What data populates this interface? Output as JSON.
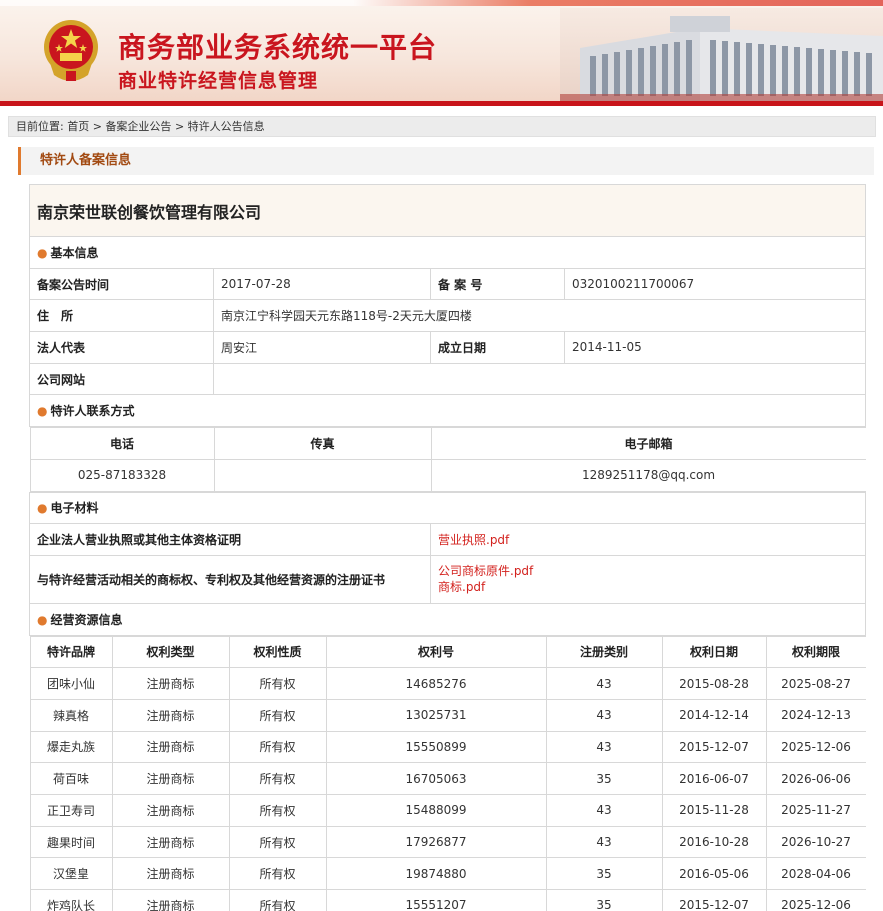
{
  "header": {
    "title": "商务部业务系统统一平台",
    "subtitle": "商业特许经营信息管理"
  },
  "breadcrumb": {
    "prefix": "目前位置:",
    "items": [
      "首页",
      "备案企业公告",
      "特许人公告信息"
    ],
    "separator": ">"
  },
  "section_title": "特许人备案信息",
  "company_name": "南京荣世联创餐饮管理有限公司",
  "basic_info": {
    "heading": "基本信息",
    "announce_date_label": "备案公告时间",
    "announce_date": "2017-07-28",
    "record_no_label": "备 案 号",
    "record_no": "0320100211700067",
    "address_label": "住　所",
    "address": "南京江宁科学园天元东路118号-2天元大厦四楼",
    "legal_rep_label": "法人代表",
    "legal_rep": "周安江",
    "founded_label": "成立日期",
    "founded": "2014-11-05",
    "website_label": "公司网站",
    "website": ""
  },
  "contact": {
    "heading": "特许人联系方式",
    "phone_label": "电话",
    "fax_label": "传真",
    "email_label": "电子邮箱",
    "phone": "025-87183328",
    "fax": "",
    "email": "1289251178@qq.com"
  },
  "materials": {
    "heading": "电子材料",
    "license_label": "企业法人营业执照或其他主体资格证明",
    "license_files": [
      "营业执照.pdf"
    ],
    "ip_label": "与特许经营活动相关的商标权、专利权及其他经营资源的注册证书",
    "ip_files": [
      "公司商标原件.pdf",
      "商标.pdf"
    ]
  },
  "resources": {
    "heading": "经营资源信息",
    "columns": [
      "特许品牌",
      "权利类型",
      "权利性质",
      "权利号",
      "注册类别",
      "权利日期",
      "权利期限"
    ],
    "rows": [
      [
        "团味小仙",
        "注册商标",
        "所有权",
        "14685276",
        "43",
        "2015-08-28",
        "2025-08-27"
      ],
      [
        "辣真格",
        "注册商标",
        "所有权",
        "13025731",
        "43",
        "2014-12-14",
        "2024-12-13"
      ],
      [
        "爆走丸族",
        "注册商标",
        "所有权",
        "15550899",
        "43",
        "2015-12-07",
        "2025-12-06"
      ],
      [
        "荷百味",
        "注册商标",
        "所有权",
        "16705063",
        "35",
        "2016-06-07",
        "2026-06-06"
      ],
      [
        "正卫寿司",
        "注册商标",
        "所有权",
        "15488099",
        "43",
        "2015-11-28",
        "2025-11-27"
      ],
      [
        "趣果时间",
        "注册商标",
        "所有权",
        "17926877",
        "43",
        "2016-10-28",
        "2026-10-27"
      ],
      [
        "汉堡皇",
        "注册商标",
        "所有权",
        "19874880",
        "35",
        "2016-05-06",
        "2028-04-06"
      ],
      [
        "炸鸡队长",
        "注册商标",
        "所有权",
        "15551207",
        "35",
        "2015-12-07",
        "2025-12-06"
      ]
    ]
  },
  "colors": {
    "brand_red": "#c9151e",
    "accent_orange": "#e07a2e",
    "link_red": "#d3221e"
  }
}
